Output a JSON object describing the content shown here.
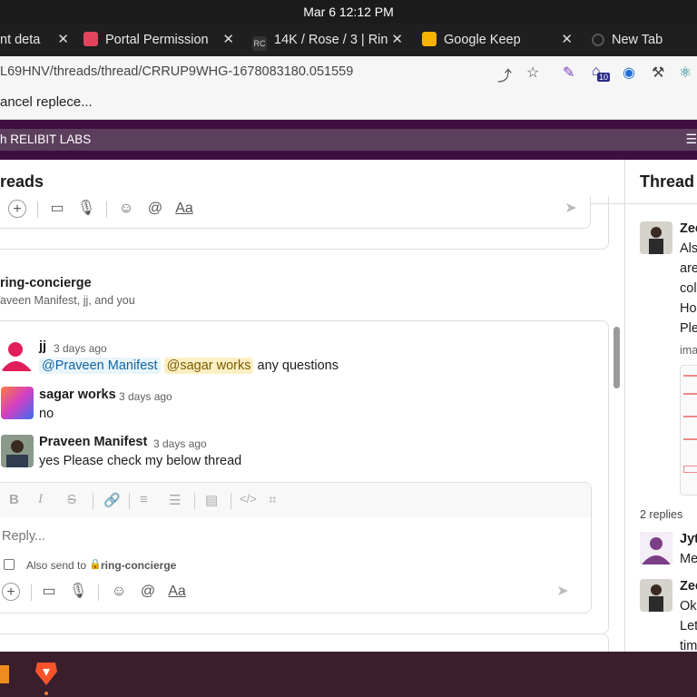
{
  "system": {
    "clock": "Mar 6  12:12 PM"
  },
  "tabs": [
    {
      "label": "nt deta",
      "icon": "page-icon"
    },
    {
      "label": "Portal Permission",
      "icon": "portal-icon"
    },
    {
      "label": "14K / Rose / 3 | Rin",
      "icon": "rc-icon"
    },
    {
      "label": "Google Keep",
      "icon": "keep-icon"
    },
    {
      "label": "New Tab",
      "icon": "globe-icon"
    }
  ],
  "address": {
    "url": "L69HNV/threads/thread/CRRUP9WHG-1678083180.051559",
    "ext_badge": "10"
  },
  "bookmarks": {
    "item": "ancel replece..."
  },
  "workspace": {
    "label": "h RELIBIT LABS"
  },
  "threads": {
    "header": "reads",
    "channel": {
      "name": "ring-concierge",
      "participants": "aveen Manifest, jj, and you"
    },
    "messages": [
      {
        "author": "jj",
        "time": "3 days ago",
        "mention1": "@Praveen Manifest",
        "mention2": "@sagar works",
        "text": "any questions"
      },
      {
        "author": "sagar works",
        "time": "3 days ago",
        "text": "no"
      },
      {
        "author": "Praveen Manifest",
        "time": "3 days ago",
        "text": "yes Please check my below thread"
      }
    ],
    "composer": {
      "placeholder": "Reply...",
      "also_send_label": "Also send to",
      "also_send_channel": "ring-concierge"
    }
  },
  "thread_panel": {
    "title": "Thread",
    "author1": "Zee",
    "lines": [
      "Als",
      "are",
      "col",
      "Ho",
      "Ple"
    ],
    "attachment_label": "ima",
    "replies": "2 replies",
    "reply1_author": "Jyt",
    "reply1_text": "Me",
    "reply2_author": "Zee",
    "reply2_lines": [
      "Ok",
      "Let",
      "tim"
    ]
  },
  "colors": {
    "aubergine": "#3f0e40",
    "mention_blue": "#1264a3",
    "mention_yellow": "#fcefc3"
  }
}
